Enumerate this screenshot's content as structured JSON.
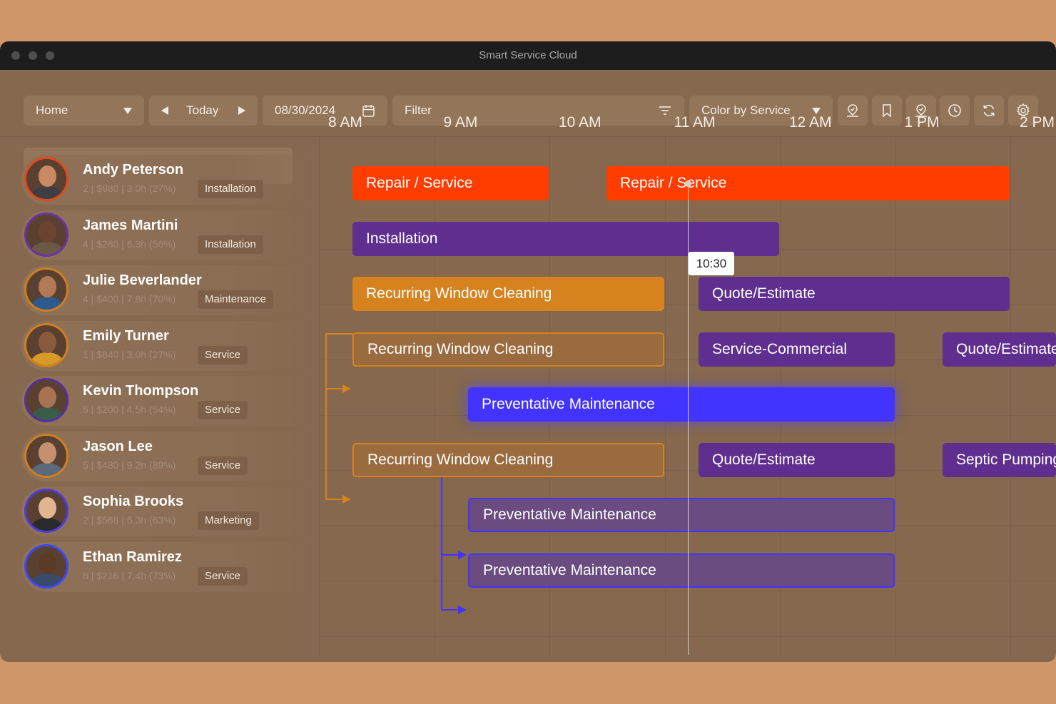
{
  "app": {
    "title": "Smart Service Cloud"
  },
  "toolbar": {
    "view_select": "Home",
    "today_label": "Today",
    "date": "08/30/2024",
    "filter_label": "Filter",
    "color_select": "Color by Service",
    "icons": [
      "map-pin-icon",
      "bookmark-icon",
      "map-pin-alt-icon",
      "clock-icon",
      "refresh-icon",
      "gear-icon"
    ]
  },
  "search": {
    "placeholder": ""
  },
  "timeline": {
    "hours": [
      "8 AM",
      "9 AM",
      "10 AM",
      "11 AM",
      "12 AM",
      "1 PM",
      "2 PM"
    ],
    "current_time": "10:30"
  },
  "technicians": [
    {
      "name": "Andy Peterson",
      "stats": "2 | $980 | 3.0h (27%)",
      "tag": "Installation",
      "ring": "#e2481d"
    },
    {
      "name": "James Martini",
      "stats": "4 | $280 | 6.3h (56%)",
      "tag": "Installation",
      "ring": "#6a34a2"
    },
    {
      "name": "Julie Beverlander",
      "stats": "4 | $400 | 7.8h (70%)",
      "tag": "Maintenance",
      "ring": "#d07f20"
    },
    {
      "name": "Emily Turner",
      "stats": "1 | $840 | 3.0h (27%)",
      "tag": "Service",
      "ring": "#d07f20"
    },
    {
      "name": "Kevin Thompson",
      "stats": "5 | $200 | 4.5h (54%)",
      "tag": "Service",
      "ring": "#5a2da0"
    },
    {
      "name": "Jason Lee",
      "stats": "5 | $480 | 9.2h (89%)",
      "tag": "Service",
      "ring": "#d07f20"
    },
    {
      "name": "Sophia Brooks",
      "stats": "2 | $568 | 6.3h (63%)",
      "tag": "Marketing",
      "ring": "#4a3ce0"
    },
    {
      "name": "Ethan Ramirez",
      "stats": "8 | $216 | 7.4h (73%)",
      "tag": "Service",
      "ring": "#3b49ff"
    }
  ],
  "jobs": [
    {
      "row": 0,
      "label": "Repair / Service",
      "start": "8:18",
      "end": "10:00",
      "color": "#ff3d00",
      "style": "solid"
    },
    {
      "row": 0,
      "label": "Repair / Service",
      "start": "10:30",
      "end": "14:00",
      "color": "#ff3d00",
      "style": "solid"
    },
    {
      "row": 1,
      "label": "Installation",
      "start": "8:18",
      "end": "12:00",
      "color": "#5f2f8f",
      "style": "solid"
    },
    {
      "row": 2,
      "label": "Recurring Window Cleaning",
      "start": "8:18",
      "end": "11:00",
      "color": "#d5821f",
      "style": "solid"
    },
    {
      "row": 2,
      "label": "Quote/Estimate",
      "start": "11:18",
      "end": "14:00",
      "color": "#5f2f8f",
      "style": "solid"
    },
    {
      "row": 3,
      "label": "Recurring Window Cleaning",
      "start": "8:18",
      "end": "11:00",
      "color": "#d5821f",
      "style": "outline"
    },
    {
      "row": 3,
      "label": "Service-Commercial",
      "start": "11:18",
      "end": "13:00",
      "color": "#5f2f8f",
      "style": "solid"
    },
    {
      "row": 3,
      "label": "Quote/Estimate",
      "start": "13:25",
      "end": "15:00",
      "color": "#5f2f8f",
      "style": "solid"
    },
    {
      "row": 4,
      "label": "Preventative Maintenance",
      "start": "9:18",
      "end": "13:00",
      "color": "#4333ff",
      "style": "glow"
    },
    {
      "row": 5,
      "label": "Recurring Window Cleaning",
      "start": "8:18",
      "end": "11:00",
      "color": "#d5821f",
      "style": "outline"
    },
    {
      "row": 5,
      "label": "Quote/Estimate",
      "start": "11:18",
      "end": "13:00",
      "color": "#5f2f8f",
      "style": "solid"
    },
    {
      "row": 5,
      "label": "Septic Pumping",
      "start": "13:25",
      "end": "15:00",
      "color": "#5f2f8f",
      "style": "solid"
    },
    {
      "row": 6,
      "label": "Preventative Maintenance",
      "start": "9:18",
      "end": "13:00",
      "color": "#4333ff",
      "style": "outline"
    },
    {
      "row": 7,
      "label": "Preventative Maintenance",
      "start": "9:18",
      "end": "13:00",
      "color": "#4333ff",
      "style": "outline"
    }
  ],
  "colors": {
    "accent_orange": "#d5821f",
    "accent_purple": "#5f2f8f",
    "accent_red": "#ff3d00",
    "accent_blue": "#4333ff"
  }
}
